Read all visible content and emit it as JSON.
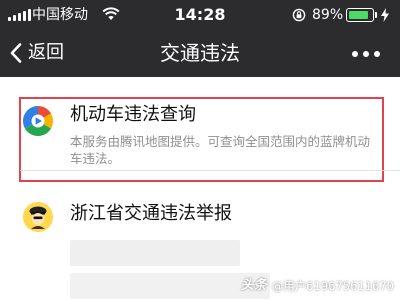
{
  "status_bar": {
    "carrier": "中国移动",
    "time": "14:28",
    "battery_percent": "89%",
    "battery_level": 0.89,
    "icons": [
      "signal-bars-icon",
      "wifi-icon",
      "rotation-lock-icon",
      "battery-icon",
      "charging-bolt-icon"
    ]
  },
  "nav": {
    "back_label": "返回",
    "title": "交通违法",
    "icons": [
      "chevron-left-icon",
      "more-dots-icon"
    ]
  },
  "list": {
    "items": [
      {
        "title": "机动车违法查询",
        "description": "本服务由腾讯地图提供。可查询全国范围内的蓝牌机动车违法。",
        "icon": "tencent-map-icon",
        "highlighted": true
      },
      {
        "title": "浙江省交通违法举报",
        "icon": "traffic-police-avatar-icon",
        "highlighted": false
      }
    ]
  },
  "watermark": {
    "logo": "头条",
    "text": "@用户6196756116​70"
  },
  "colors": {
    "header_bg": "#2c2c2e",
    "highlight_border": "#e0434e",
    "battery_green": "#4cd964"
  }
}
